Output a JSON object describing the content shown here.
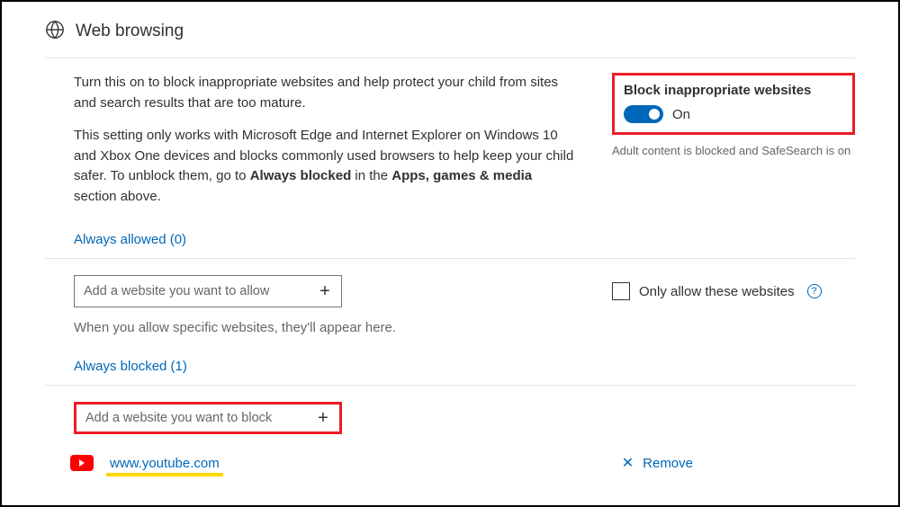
{
  "header": {
    "title": "Web browsing"
  },
  "description": {
    "p1": "Turn this on to block inappropriate websites and help protect your child from sites and search results that are too mature.",
    "p2_prefix": "This setting only works with Microsoft Edge and Internet Explorer on Windows 10 and Xbox One devices and blocks commonly used browsers to help keep your child safer. To unblock them, go to ",
    "p2_bold1": "Always blocked",
    "p2_mid": " in the ",
    "p2_bold2": "Apps, games & media",
    "p2_suffix": " section above."
  },
  "toggle": {
    "label": "Block inappropriate websites",
    "state": "On",
    "note": "Adult content is blocked and SafeSearch is on"
  },
  "allowed": {
    "heading": "Always allowed (0)",
    "placeholder": "Add a website you want to allow",
    "hint": "When you allow specific websites, they'll appear here.",
    "only_label": "Only allow these websites"
  },
  "blocked": {
    "heading": "Always blocked (1)",
    "placeholder": "Add a website you want to block",
    "items": [
      {
        "url": "www.youtube.com"
      }
    ],
    "remove_label": "Remove"
  }
}
